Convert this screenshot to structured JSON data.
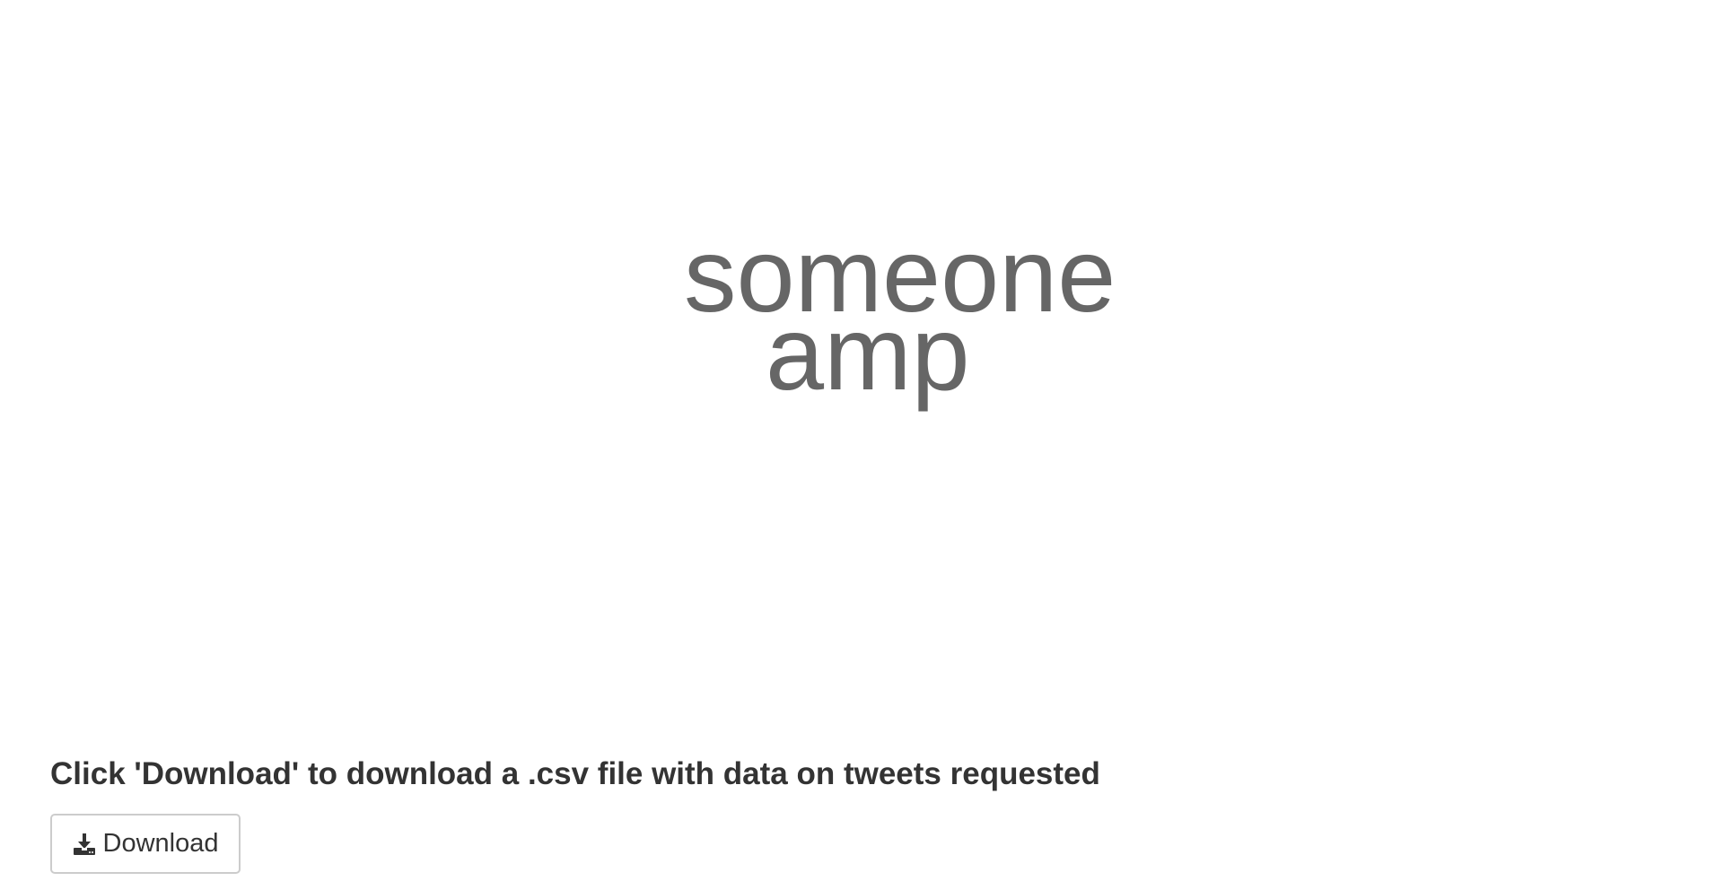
{
  "wordcloud": {
    "words": [
      "someone",
      "amp"
    ],
    "color": "#666666"
  },
  "download": {
    "heading": "Click 'Download' to download a .csv file with data on tweets requested",
    "button_label": "Download",
    "icon": "download-icon"
  }
}
